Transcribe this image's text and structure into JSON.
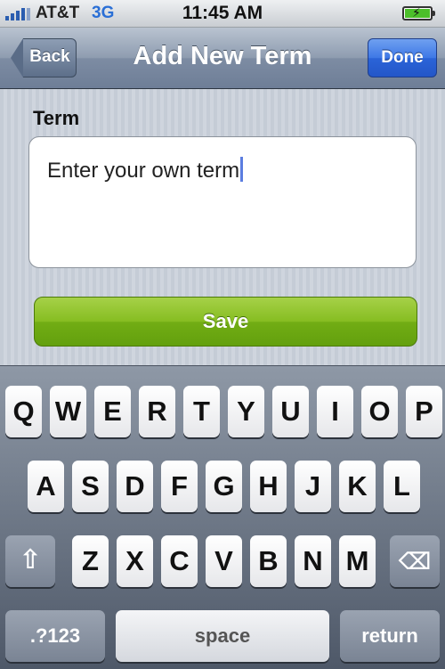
{
  "status_bar": {
    "carrier": "AT&T",
    "network": "3G",
    "time": "11:45 AM",
    "battery_level": 1.0,
    "signal_icon": "signal-bars-icon",
    "battery_icon": "battery-charging-icon"
  },
  "nav": {
    "back_label": "Back",
    "title": "Add New Term",
    "done_label": "Done"
  },
  "form": {
    "term_label": "Term",
    "term_value": "Enter your own term",
    "save_label": "Save"
  },
  "keyboard": {
    "row1": [
      "Q",
      "W",
      "E",
      "R",
      "T",
      "Y",
      "U",
      "I",
      "O",
      "P"
    ],
    "row2": [
      "A",
      "S",
      "D",
      "F",
      "G",
      "H",
      "J",
      "K",
      "L"
    ],
    "row3": [
      "Z",
      "X",
      "C",
      "V",
      "B",
      "N",
      "M"
    ],
    "shift_icon": "shift-arrow-icon",
    "delete_icon": "backspace-icon",
    "numbers_label": ".?123",
    "space_label": "space",
    "return_label": "return"
  },
  "colors": {
    "nav_bar": "#7d8ca3",
    "done_button": "#3e78e6",
    "save_button": "#86bd21",
    "network_text": "#2a6fd6"
  }
}
